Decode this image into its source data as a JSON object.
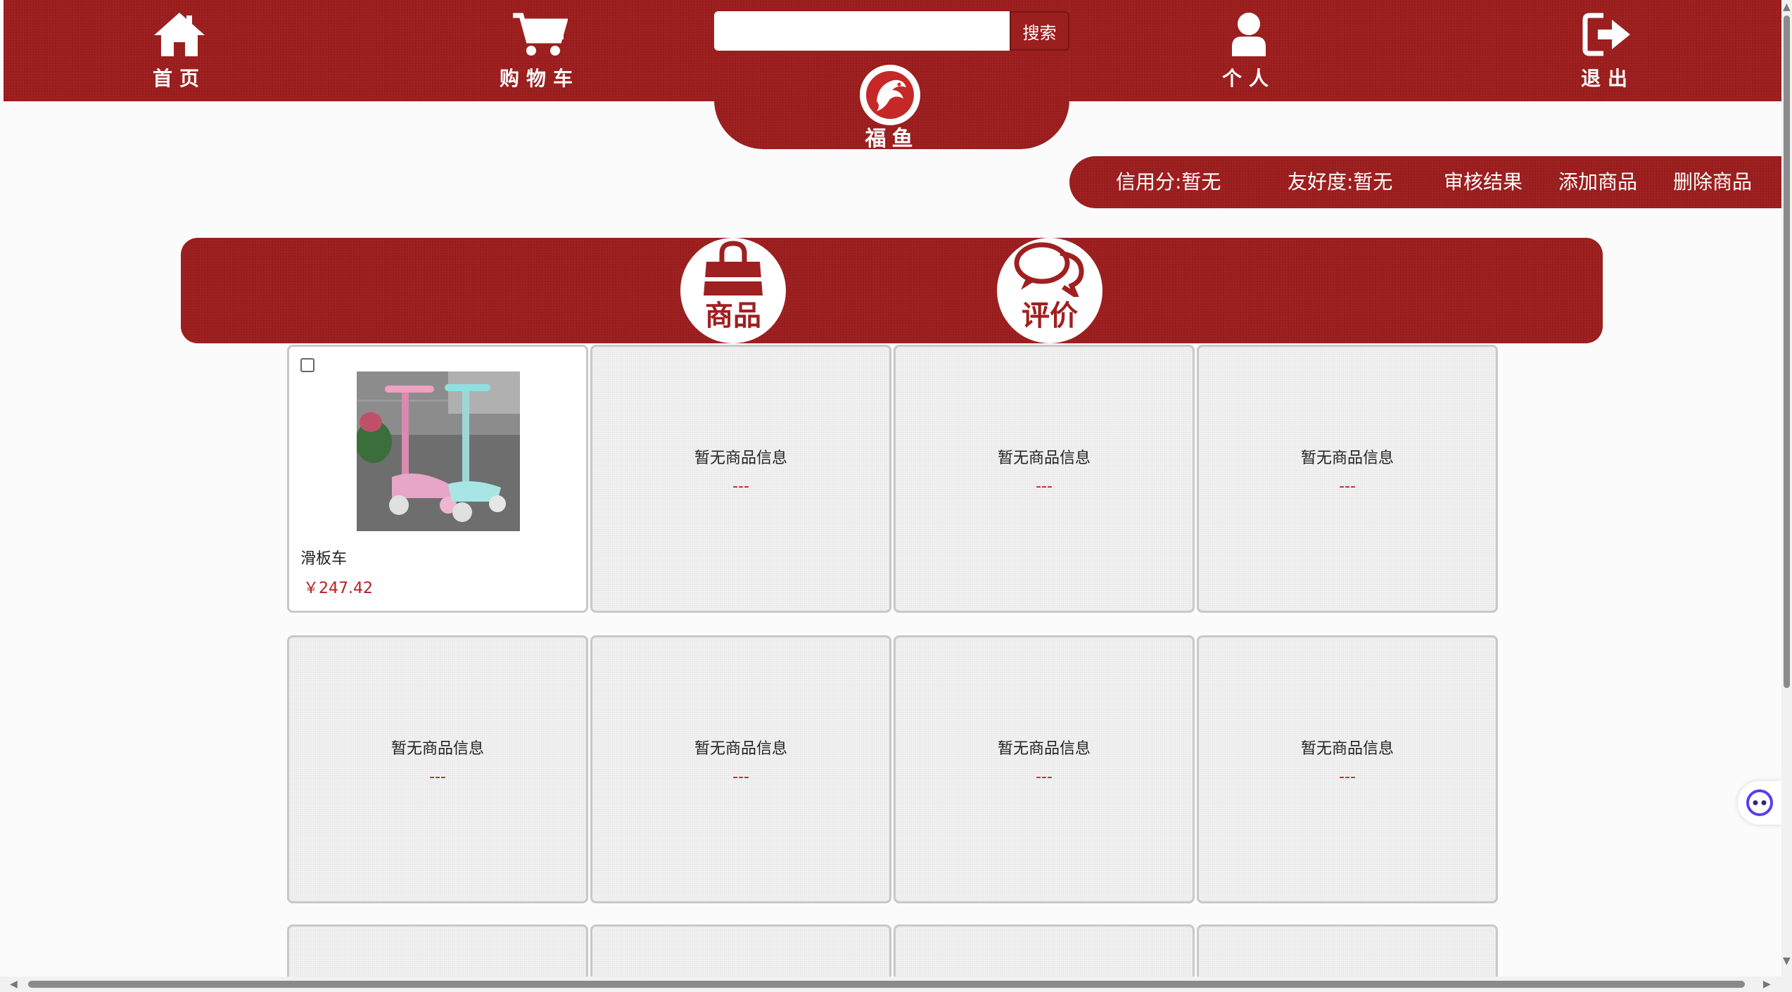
{
  "nav": {
    "home": "首页",
    "cart": "购物车",
    "profile": "个人",
    "logout": "退出"
  },
  "search": {
    "placeholder": "",
    "button": "搜索"
  },
  "logo": {
    "text": "福鱼"
  },
  "subnav": {
    "credit": "信用分:暂无",
    "friendliness": "友好度:暂无",
    "review_result": "审核结果",
    "add_product": "添加商品",
    "delete_product": "删除商品"
  },
  "categories": {
    "products": "商品",
    "reviews": "评价"
  },
  "product": {
    "name": "滑板车",
    "price": "￥247.42"
  },
  "empty": {
    "text": "暂无商品信息",
    "dash": "---"
  },
  "colors": {
    "brand": "#9f2020",
    "price": "#b22222"
  }
}
